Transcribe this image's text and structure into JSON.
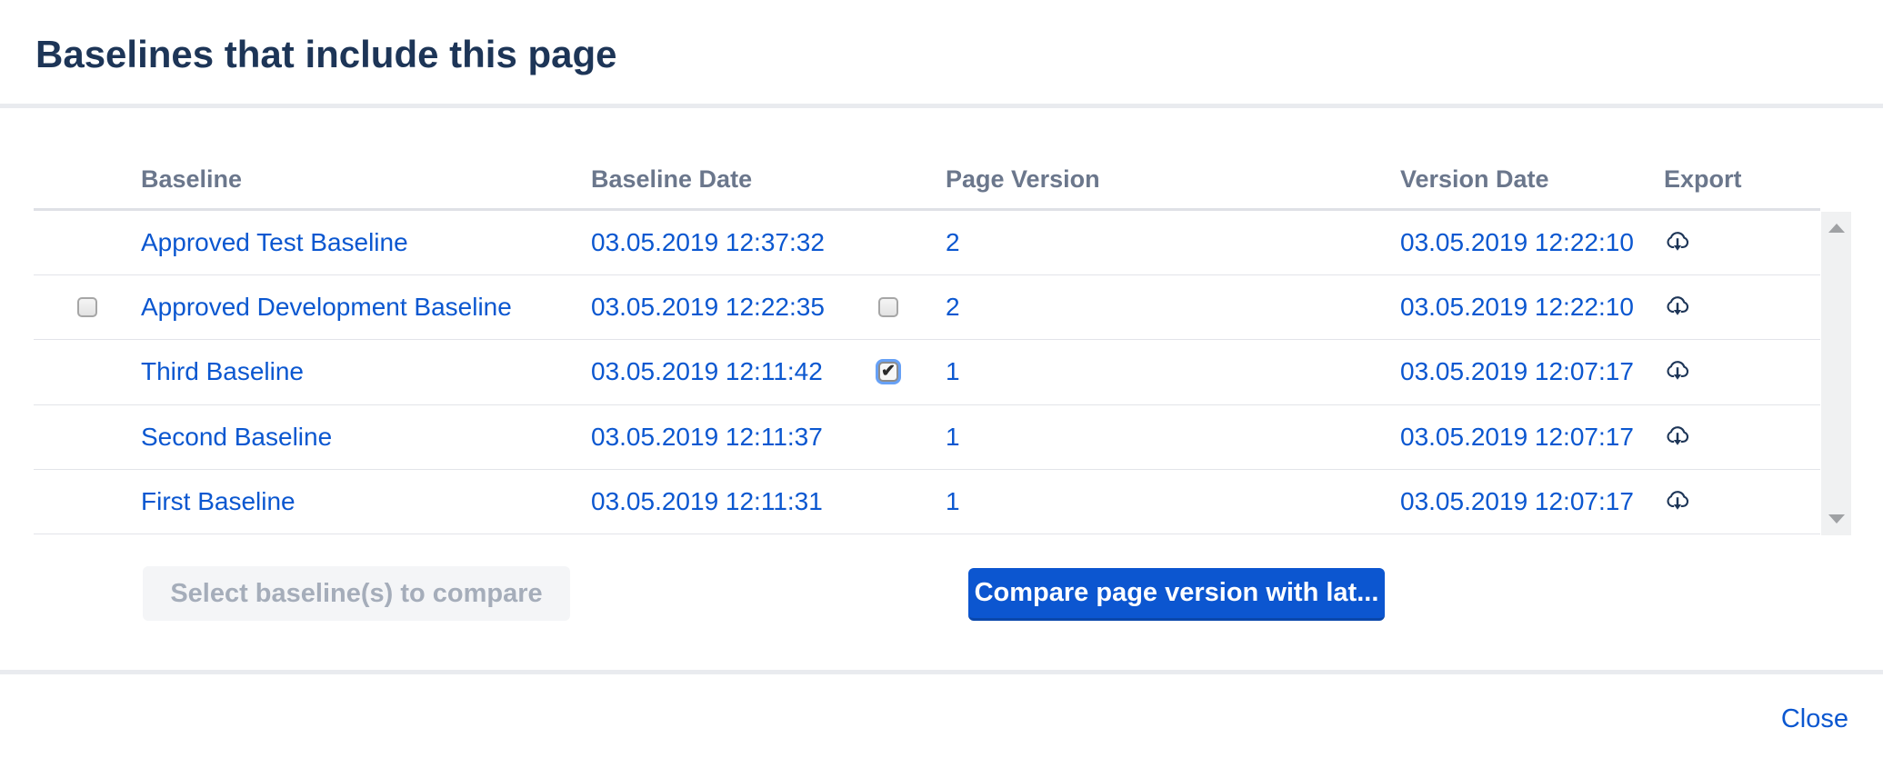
{
  "dialog": {
    "title": "Baselines that include this page",
    "close_label": "Close"
  },
  "table": {
    "columns": [
      "Baseline",
      "Baseline Date",
      "Page Version",
      "Version Date",
      "Export"
    ],
    "checkmark_glyph": "✔",
    "export_icon": "cloud-download-icon",
    "rows": [
      {
        "baseline": "Approved Test Baseline",
        "baseline_date": "03.05.2019 12:37:32",
        "row_checkbox": false,
        "row_checkbox_checked": false,
        "page_version": "2",
        "version_checkbox": false,
        "version_checkbox_checked": false,
        "version_date": "03.05.2019 12:22:10"
      },
      {
        "baseline": "Approved Development Baseline",
        "baseline_date": "03.05.2019 12:22:35",
        "row_checkbox": true,
        "row_checkbox_checked": false,
        "page_version": "2",
        "version_checkbox": true,
        "version_checkbox_checked": false,
        "version_date": "03.05.2019 12:22:10"
      },
      {
        "baseline": "Third Baseline",
        "baseline_date": "03.05.2019 12:11:42",
        "row_checkbox": false,
        "row_checkbox_checked": false,
        "page_version": "1",
        "version_checkbox": true,
        "version_checkbox_checked": true,
        "version_date": "03.05.2019 12:07:17"
      },
      {
        "baseline": "Second Baseline",
        "baseline_date": "03.05.2019 12:11:37",
        "row_checkbox": false,
        "row_checkbox_checked": false,
        "page_version": "1",
        "version_checkbox": false,
        "version_checkbox_checked": false,
        "version_date": "03.05.2019 12:07:17"
      },
      {
        "baseline": "First Baseline",
        "baseline_date": "03.05.2019 12:11:31",
        "row_checkbox": false,
        "row_checkbox_checked": false,
        "page_version": "1",
        "version_checkbox": false,
        "version_checkbox_checked": false,
        "version_date": "03.05.2019 12:07:17"
      }
    ]
  },
  "buttons": {
    "select_compare_label": "Select baseline(s) to compare",
    "compare_latest_label": "Compare page version with lat..."
  },
  "scrollbar": {
    "up_icon": "scroll-up-icon",
    "down_icon": "scroll-down-icon"
  },
  "colors": {
    "link_blue": "#0B57D0",
    "title_navy": "#1D3557",
    "column_header_gray": "#6B778C",
    "primary_button_blue": "#0C56D0",
    "disabled_button_bg": "#F4F5F7",
    "disabled_button_text": "#A5ADBA",
    "divider_band": "#E9EBEF",
    "icon_navy": "#1D3557"
  }
}
